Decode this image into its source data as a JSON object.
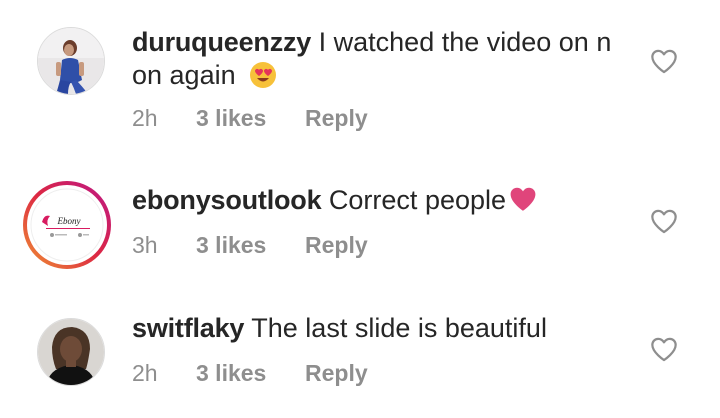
{
  "comments": [
    {
      "username": "duruqueenzzy",
      "text_line1": "I watched the video on n",
      "text_line2": "on again",
      "emoji": "smiling-face-with-heart-eyes",
      "time": "2h",
      "likes": "3 likes",
      "reply": "Reply"
    },
    {
      "username": "ebonysoutlook",
      "text": "Correct people",
      "emoji": "heart",
      "avatar_logo_text": "EbonySoutLook",
      "time": "3h",
      "likes": "3 likes",
      "reply": "Reply"
    },
    {
      "username": "switflaky",
      "text": "The last slide is beautiful",
      "time": "2h",
      "likes": "3 likes",
      "reply": "Reply"
    }
  ],
  "colors": {
    "text": "#262626",
    "meta": "#8e8e8e",
    "heart_outline": "#8e8e8e",
    "story_ring_start": "#f09433",
    "story_ring_end": "#bc1888",
    "pink_heart": "#e0457b"
  },
  "icons": {
    "like": "heart-outline-icon"
  }
}
